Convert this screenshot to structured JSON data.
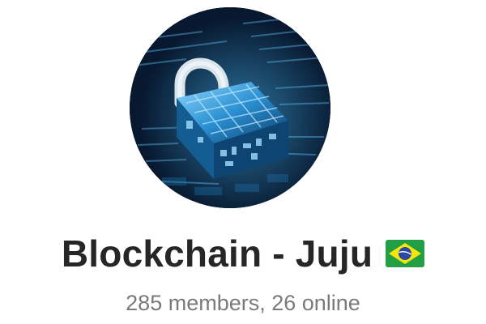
{
  "chat": {
    "avatar_icon": "padlock-circuit-icon",
    "title": "Blockchain - Juju",
    "flag_icon": "brazil-flag-icon",
    "members_text": "285 members, 26 online"
  },
  "colors": {
    "title": "#262626",
    "subtitle": "#7a7a7a",
    "avatar_bg": "#0c2f52",
    "avatar_glow": "#3fb6f0",
    "flag_green": "#229e45",
    "flag_yellow": "#f8e509",
    "flag_blue": "#2b49a3"
  }
}
